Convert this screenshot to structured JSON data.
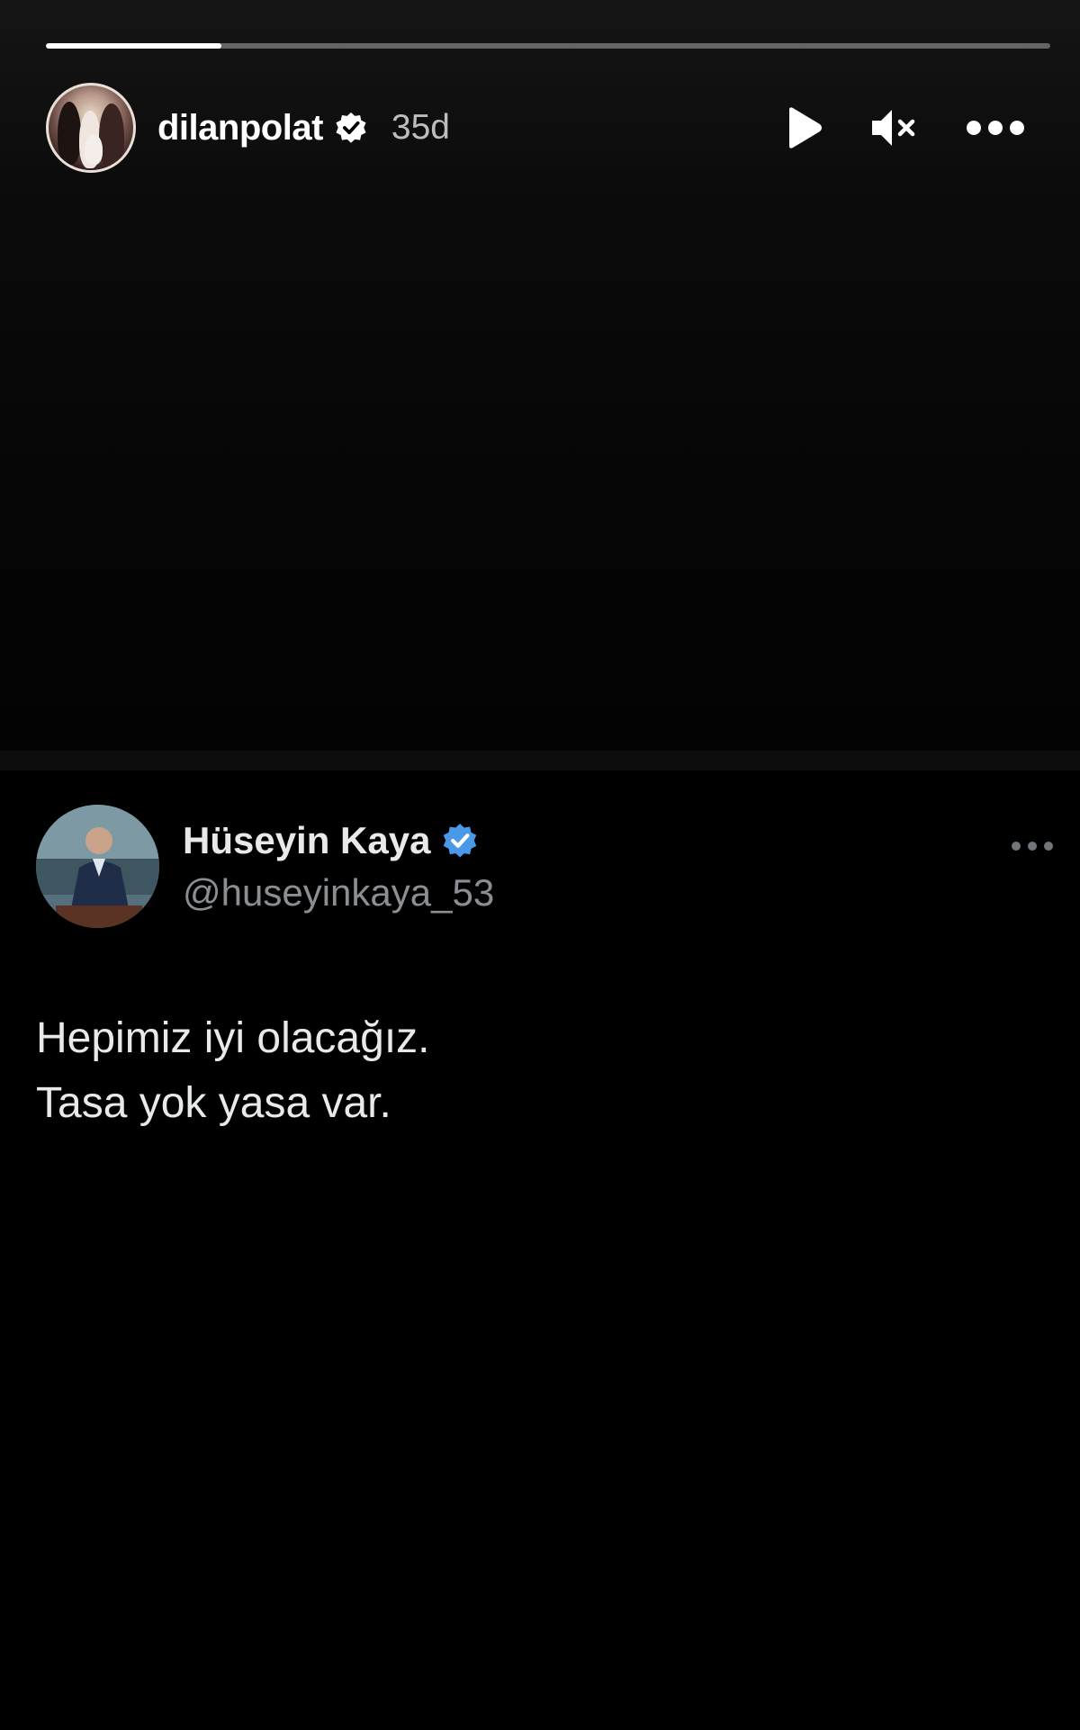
{
  "story": {
    "progress_fraction": 0.175,
    "username": "dilanpolat",
    "time": "35d",
    "icons": {
      "verified": "verified-badge-icon",
      "play": "play-icon",
      "mute": "muted-speaker-icon",
      "more": "more-horizontal-icon"
    }
  },
  "tweet": {
    "name": "Hüseyin Kaya",
    "handle": "@huseyinkaya_53",
    "lines": [
      "Hepimiz iyi olacağız.",
      "Tasa yok yasa var."
    ],
    "verified_color": "#4a99e9",
    "icons": {
      "verified": "verified-badge-icon",
      "more": "more-horizontal-icon"
    }
  }
}
